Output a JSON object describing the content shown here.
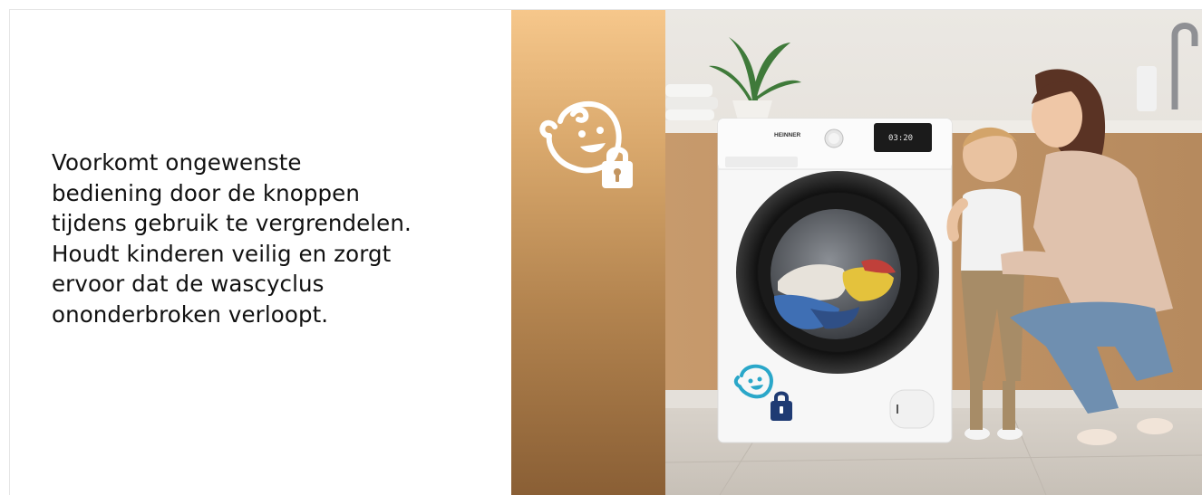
{
  "description": {
    "lines": [
      "Voorkomt ongewenste",
      "bediening door de knoppen",
      "tijdens gebruik te vergrendelen.",
      "Houdt kinderen veilig en zorgt",
      "ervoor dat de wascyclus",
      "ononderbroken verloopt."
    ]
  },
  "machine": {
    "brand": "HEINNER",
    "display_time": "03:20"
  },
  "icons": {
    "band_icon": "child-lock-icon",
    "machine_icon": "child-lock-icon"
  },
  "colors": {
    "gold_top": "#f6c78b",
    "gold_bottom": "#8a5f35",
    "icon_teal": "#2aa7c9",
    "icon_navy": "#1f3b73"
  }
}
